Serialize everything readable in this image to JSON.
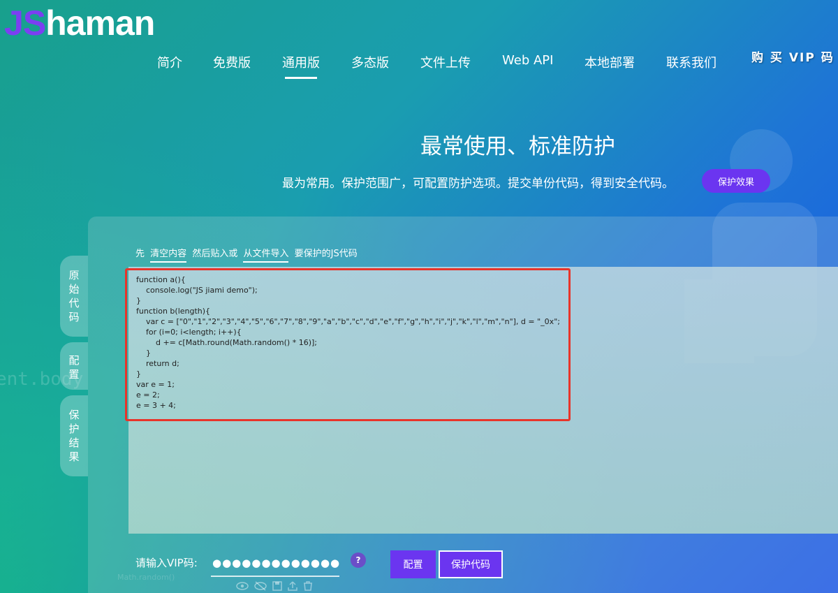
{
  "logo": {
    "j": "J",
    "s": "S",
    "rest": "haman"
  },
  "nav": {
    "items": [
      "简介",
      "免费版",
      "通用版",
      "多态版",
      "文件上传",
      "Web API",
      "本地部署",
      "联系我们"
    ],
    "buy_vip": "购 买 VIP 码"
  },
  "hero": {
    "title": "最常使用、标准防护",
    "subtitle": "最为常用。保护范围广，可配置防护选项。提交单份代码，得到安全代码。",
    "effect_button": "保护效果"
  },
  "side_tabs": [
    {
      "chars": [
        "原",
        "始",
        "代",
        "码"
      ]
    },
    {
      "chars": [
        "配",
        "置"
      ]
    },
    {
      "chars": [
        "保",
        "护",
        "结",
        "果"
      ]
    }
  ],
  "instruction": {
    "prefix": "先",
    "clear": "清空内容",
    "middle": "然后贴入或",
    "import": "从文件导入",
    "suffix": "要保护的JS代码"
  },
  "code": "function a(){\n    console.log(\"JS jiami demo\");\n}\nfunction b(length){\n    var c = [\"0\",\"1\",\"2\",\"3\",\"4\",\"5\",\"6\",\"7\",\"8\",\"9\",\"a\",\"b\",\"c\",\"d\",\"e\",\"f\",\"g\",\"h\",\"i\",\"j\",\"k\",\"l\",\"m\",\"n\"], d = \"_0x\";\n    for (i=0; i<length; i++){\n        d += c[Math.round(Math.random() * 16)];\n    }\n    return d;\n}\nvar e = 1;\ne = 2;\ne = 3 + 4;",
  "vip": {
    "label": "请输入VIP码:",
    "value": "●●●●●●●●●●●●●●●●●●●●●●●●",
    "help": "?"
  },
  "buttons": {
    "config": "配置",
    "protect": "保护代码"
  },
  "decor": {
    "bg_code": "ent.body",
    "bg_small": "Math.random()"
  },
  "icons": [
    "eye-icon",
    "eye-slash-icon",
    "save-icon",
    "upload-icon",
    "trash-icon"
  ],
  "colors": {
    "accent": "#6b35f0",
    "highlight": "#e8342a"
  }
}
